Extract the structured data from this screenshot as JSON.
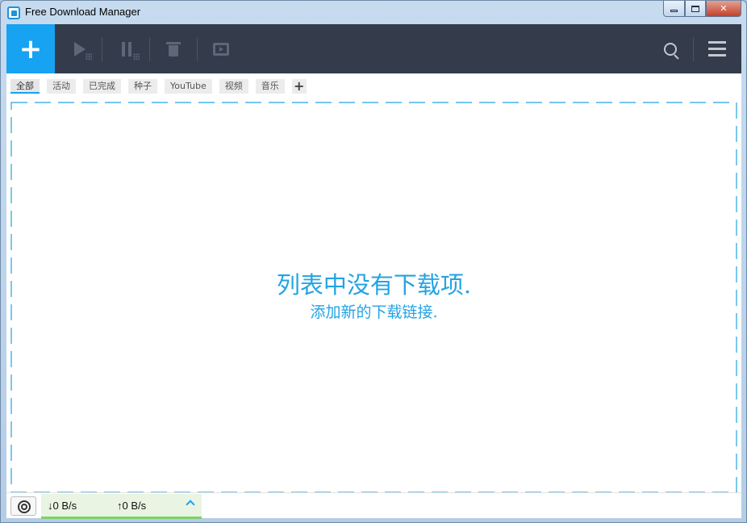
{
  "window": {
    "title": "Free Download Manager"
  },
  "toolbar": {
    "add_icon": "+",
    "icons": [
      "plus-icon",
      "play-icon",
      "pause-icon",
      "trash-icon",
      "move-icon",
      "search-icon",
      "menu-icon"
    ]
  },
  "tabs": {
    "items": [
      {
        "label": "全部",
        "active": true
      },
      {
        "label": "活动",
        "active": false
      },
      {
        "label": "已完成",
        "active": false
      },
      {
        "label": "种子",
        "active": false
      },
      {
        "label": "YouTube",
        "active": false
      },
      {
        "label": "视频",
        "active": false
      },
      {
        "label": "音乐",
        "active": false
      }
    ],
    "add_label": "+"
  },
  "main": {
    "empty_title": "列表中没有下载项.",
    "empty_subtitle": "添加新的下载链接."
  },
  "status": {
    "download_speed": "↓0 B/s",
    "upload_speed": "↑0 B/s"
  },
  "colors": {
    "accent": "#17a2f2",
    "toolbar_bg": "#343b4b",
    "text_blue": "#23a3e3",
    "speed_bar": "#7ed16a"
  }
}
